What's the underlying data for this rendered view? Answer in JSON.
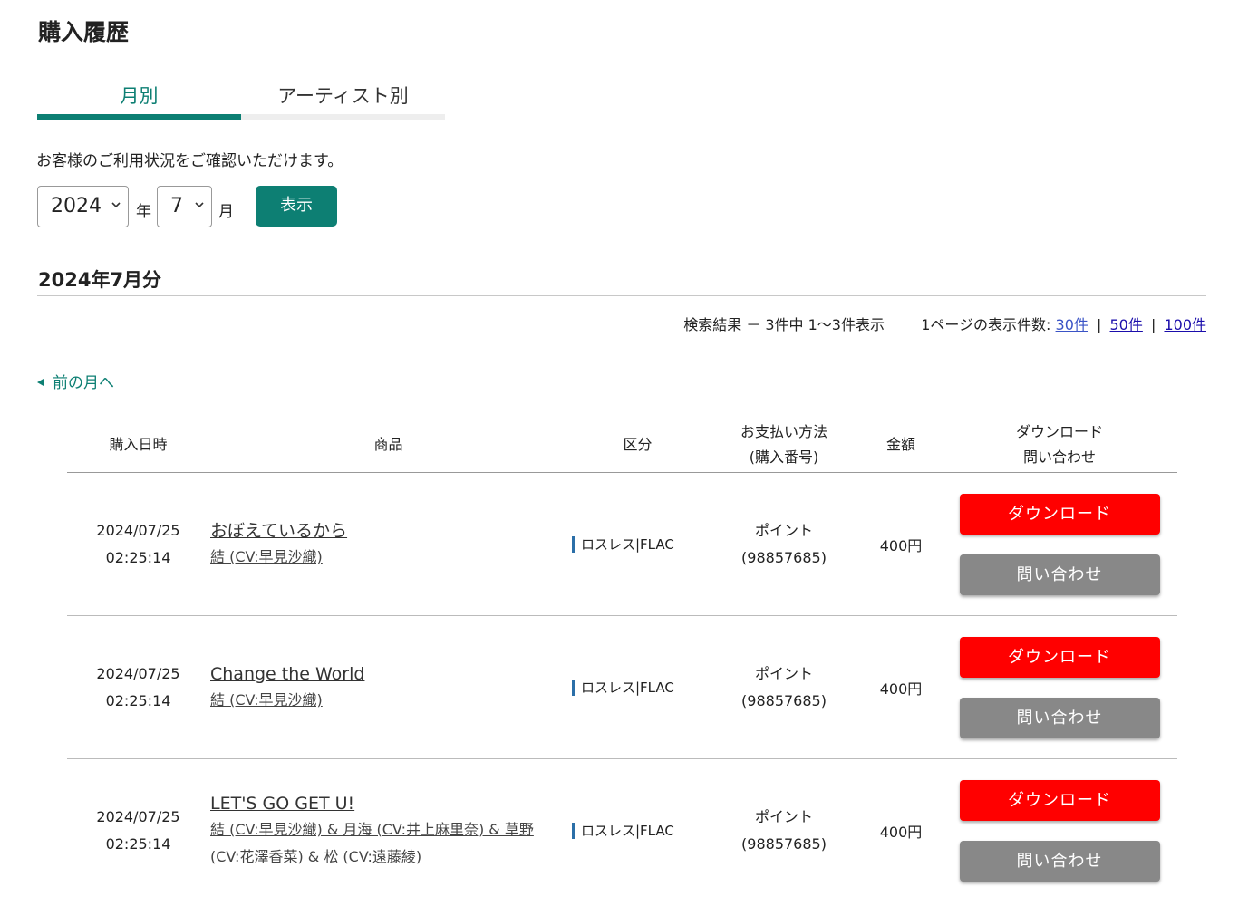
{
  "page": {
    "title": "購入履歴"
  },
  "tabs": [
    {
      "label": "月別",
      "active": true
    },
    {
      "label": "アーティスト別",
      "active": false
    }
  ],
  "intro": "お客様のご利用状況をご確認いただけます。",
  "selector": {
    "year_value": "2024",
    "year_unit": "年",
    "month_value": "7",
    "month_unit": "月",
    "show_button": "表示"
  },
  "section": {
    "title": "2024年7月分"
  },
  "results": {
    "summary": "検索結果 － 3件中 1～3件表示",
    "per_page_label": "1ページの表示件数:",
    "per_page_options": [
      "30件",
      "50件",
      "100件"
    ],
    "per_page_selected": "30件"
  },
  "nav": {
    "prev_month": "前の月へ"
  },
  "table": {
    "headers": {
      "date": "購入日時",
      "item": "商品",
      "type": "区分",
      "payment": "お支払い方法\n(購入番号)",
      "price": "金額",
      "download": "ダウンロード\n問い合わせ"
    },
    "rows": [
      {
        "date": "2024/07/25",
        "time": "02:25:14",
        "title": "おぼえているから",
        "artist": "結 (CV:早見沙織)",
        "type": "ロスレス|FLAC",
        "payment_method": "ポイント",
        "purchase_no": "(98857685)",
        "price": "400円",
        "download_label": "ダウンロード",
        "inquiry_label": "問い合わせ"
      },
      {
        "date": "2024/07/25",
        "time": "02:25:14",
        "title": "Change the World",
        "artist": "結 (CV:早見沙織)",
        "type": "ロスレス|FLAC",
        "payment_method": "ポイント",
        "purchase_no": "(98857685)",
        "price": "400円",
        "download_label": "ダウンロード",
        "inquiry_label": "問い合わせ"
      },
      {
        "date": "2024/07/25",
        "time": "02:25:14",
        "title": "LET'S GO GET U!",
        "artist": "結 (CV:早見沙織) & 月海 (CV:井上麻里奈) & 草野 (CV:花澤香菜) & 松 (CV:遠藤綾)",
        "type": "ロスレス|FLAC",
        "payment_method": "ポイント",
        "purchase_no": "(98857685)",
        "price": "400円",
        "download_label": "ダウンロード",
        "inquiry_label": "問い合わせ"
      }
    ]
  },
  "colors": {
    "accent": "#0d7f73",
    "download_button": "#ff0000",
    "inquiry_button": "#888888",
    "type_marker": "#2b6fa8",
    "link": "#1a0dab"
  },
  "icons": {
    "select_chevron": "chevron-down-icon",
    "prev_arrow": "triangle-left-icon"
  }
}
